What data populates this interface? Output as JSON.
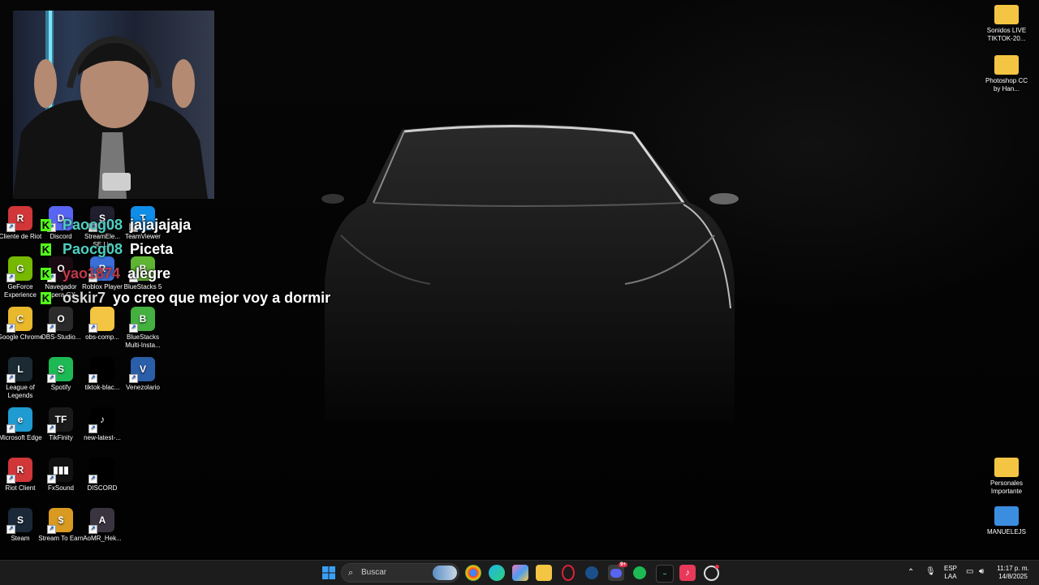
{
  "desktop": {
    "icons_left": [
      {
        "id": "riot",
        "label": "Cliente de Riot",
        "color": "#d13639",
        "glyph": "R"
      },
      {
        "id": "discord",
        "label": "Discord",
        "color": "#5865f2",
        "glyph": "D"
      },
      {
        "id": "streamelements",
        "label": "StreamEle... SE.Liv",
        "color": "#1f1f2e",
        "glyph": "S"
      },
      {
        "id": "teamviewer",
        "label": "TeamViewer",
        "color": "#0e8ee9",
        "glyph": "T"
      },
      {
        "id": "geforce",
        "label": "GeForce Experience",
        "color": "#76b900",
        "glyph": "G"
      },
      {
        "id": "opera",
        "label": "Navegador Opera GX",
        "color": "#1a0b12",
        "glyph": "O"
      },
      {
        "id": "roblox",
        "label": "Roblox Player",
        "color": "#3a6fd8",
        "glyph": "R"
      },
      {
        "id": "bluestacks5",
        "label": "BlueStacks 5",
        "color": "#5fb533",
        "glyph": "B"
      },
      {
        "id": "chrome",
        "label": "Google Chrome",
        "color": "#e9b82c",
        "glyph": "C"
      },
      {
        "id": "obs",
        "label": "OBS-Studio...",
        "color": "#2b2b2b",
        "glyph": "O"
      },
      {
        "id": "obscomp",
        "label": "obs-comp...",
        "color": "#f4c542",
        "glyph": ""
      },
      {
        "id": "bluestacksmulti",
        "label": "BlueStacks Multi-Insta...",
        "color": "#44b040",
        "glyph": "B"
      },
      {
        "id": "lol",
        "label": "League of Legends",
        "color": "#1b2a33",
        "glyph": "L"
      },
      {
        "id": "spotify",
        "label": "Spotify",
        "color": "#1db954",
        "glyph": "S"
      },
      {
        "id": "tiktokblack",
        "label": "tiktok-blac...",
        "color": "#000000",
        "glyph": ""
      },
      {
        "id": "venezolario",
        "label": "Venezolario",
        "color": "#2a5ea8",
        "glyph": "V"
      },
      {
        "id": "edge",
        "label": "Microsoft Edge",
        "color": "#1f9bd1",
        "glyph": "e"
      },
      {
        "id": "tikfinity",
        "label": "TikFinity",
        "color": "#1a1a1a",
        "glyph": "TF"
      },
      {
        "id": "newlatest",
        "label": "new-latest-...",
        "color": "#000000",
        "glyph": "♪"
      },
      {
        "id": "riotclient",
        "label": "Riot Client",
        "color": "#d13639",
        "glyph": "R"
      },
      {
        "id": "fxsound",
        "label": "FxSound",
        "color": "#111111",
        "glyph": "▮▮▮"
      },
      {
        "id": "discordfolder",
        "label": "DISCORD",
        "color": "#000000",
        "glyph": ""
      },
      {
        "id": "steam",
        "label": "Steam",
        "color": "#1b2838",
        "glyph": "S"
      },
      {
        "id": "streamtoearn",
        "label": "Stream To Earn",
        "color": "#d89a20",
        "glyph": "$"
      },
      {
        "id": "aomr",
        "label": "AoMR_Hek...",
        "color": "#3a3440",
        "glyph": "A"
      }
    ],
    "icons_right": [
      {
        "id": "sonidos",
        "label": "Sonidos LIVE TIKTOK-20...",
        "color": "#f4c542",
        "glyph": ""
      },
      {
        "id": "photoshop",
        "label": "Photoshop CC by Han...",
        "color": "#f4c542",
        "glyph": ""
      },
      {
        "id": "personales",
        "label": "Personales Importante",
        "color": "#f4c542",
        "glyph": ""
      },
      {
        "id": "manuelejs",
        "label": "MANUELEJS",
        "color": "#3b8de0",
        "glyph": ""
      }
    ]
  },
  "chat": [
    {
      "user": "Paocg08",
      "user_color": "#4ecfc0",
      "message": "jajajajaja"
    },
    {
      "user": "Paocg08",
      "user_color": "#4ecfc0",
      "message": "Piceta"
    },
    {
      "user": "yao1874",
      "user_color": "#c03a4a",
      "message": "alegre"
    },
    {
      "user": "oskir7",
      "user_color": "#d8d8d8",
      "message": "yo creo que mejor voy a dormir"
    }
  ],
  "taskbar": {
    "search_placeholder": "Buscar",
    "apps": [
      "start-icon",
      "chrome-icon",
      "edge-icon",
      "copilot-icon",
      "file-explorer-icon",
      "opera-gx-icon",
      "steam-icon",
      "discord-icon",
      "spotify-icon",
      "terminal-icon",
      "tiktok-icon",
      "obs-icon"
    ],
    "discord_badge": "9+",
    "language": "ESP",
    "language_sub": "LAA",
    "time": "11:17 p. m.",
    "date": "14/8/2025"
  }
}
